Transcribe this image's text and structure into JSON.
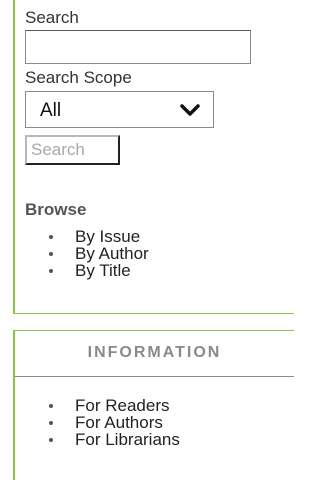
{
  "search": {
    "label": "Search",
    "input_value": "",
    "scope_label": "Search Scope",
    "scope_selected": "All",
    "button_label": "Search"
  },
  "browse": {
    "heading": "Browse",
    "items": [
      {
        "label": "By Issue"
      },
      {
        "label": "By Author"
      },
      {
        "label": "By Title"
      }
    ]
  },
  "information": {
    "heading": "INFORMATION",
    "items": [
      {
        "label": "For Readers"
      },
      {
        "label": "For Authors"
      },
      {
        "label": "For Librarians"
      }
    ]
  },
  "colors": {
    "accent_border": "#8bc34a",
    "heading_gray": "#8a8a8a",
    "button_text_disabled": "#a8a8a8"
  },
  "icons": {
    "scope_dropdown": "chevron-down-icon"
  }
}
